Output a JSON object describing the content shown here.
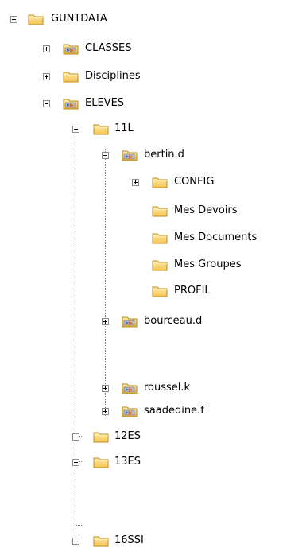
{
  "tree": {
    "root": {
      "label": "GUNTDATA"
    },
    "classes": {
      "label": "CLASSES"
    },
    "disciplines": {
      "label": "Disciplines"
    },
    "eleves": {
      "label": "ELEVES"
    },
    "c11l": {
      "label": "11L"
    },
    "bertin": {
      "label": "bertin.d"
    },
    "config": {
      "label": "CONFIG"
    },
    "devoirs": {
      "label": "Mes Devoirs"
    },
    "documents": {
      "label": "Mes Documents"
    },
    "groupes": {
      "label": "Mes Groupes"
    },
    "profil": {
      "label": "PROFIL"
    },
    "bourceau": {
      "label": "bourceau.d"
    },
    "roussel": {
      "label": "roussel.k"
    },
    "saadedine": {
      "label": "saadedine.f"
    },
    "c12es": {
      "label": "12ES"
    },
    "c13es": {
      "label": "13ES"
    },
    "c16ssi": {
      "label": "16SSI"
    }
  }
}
